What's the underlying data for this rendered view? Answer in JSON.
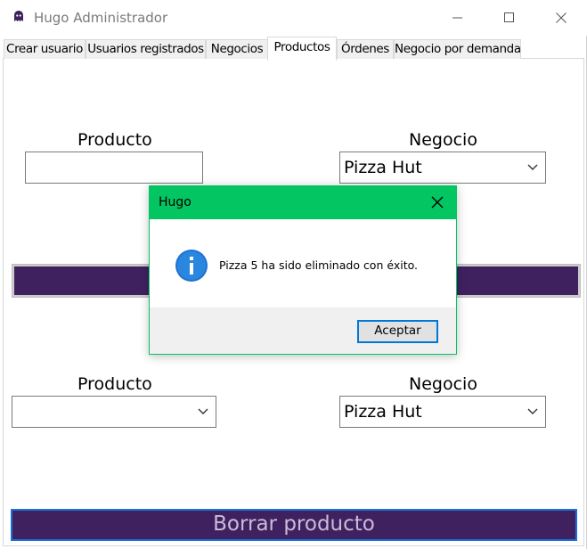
{
  "window": {
    "title": "Hugo Administrador",
    "icon": "ghost-icon"
  },
  "tabs": [
    {
      "label": "Crear usuario"
    },
    {
      "label": "Usuarios registrados"
    },
    {
      "label": "Negocios"
    },
    {
      "label": "Productos",
      "active": true
    },
    {
      "label": "Órdenes"
    },
    {
      "label": "Negocio por demanda"
    }
  ],
  "form_top": {
    "product_label": "Producto",
    "product_value": "",
    "business_label": "Negocio",
    "business_value": "Pizza Hut"
  },
  "form_bottom": {
    "product_label": "Producto",
    "product_value": "",
    "business_label": "Negocio",
    "business_value": "Pizza Hut",
    "delete_button": "Borrar producto"
  },
  "dialog": {
    "title": "Hugo",
    "message": "Pizza 5 ha sido eliminado con éxito.",
    "ok_button": "Aceptar",
    "icon": "info-icon",
    "title_color": "#03c562"
  },
  "colors": {
    "accent_purple": "#3f2160",
    "dialog_green": "#03c562",
    "focus_blue": "#0078d7"
  }
}
